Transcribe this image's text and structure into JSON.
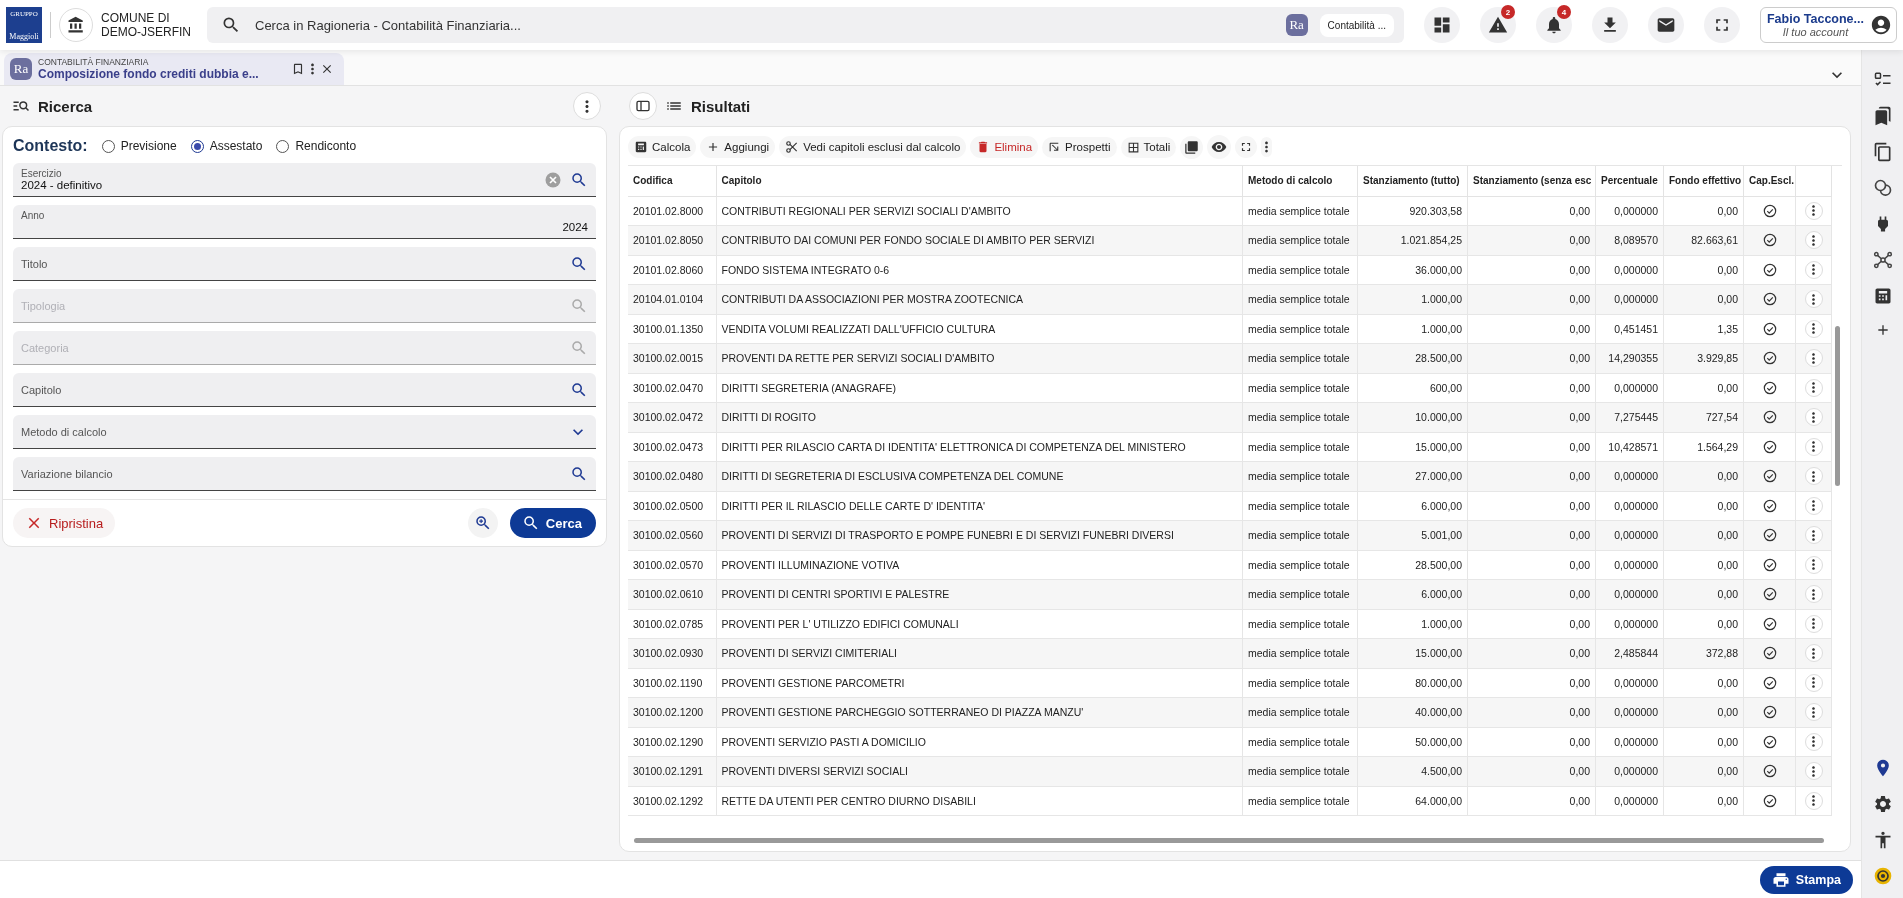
{
  "header": {
    "logo": {
      "top": "GRUPPO",
      "name": "Maggioli"
    },
    "entity": "COMUNE DI DEMO-JSERFIN",
    "search": {
      "placeholder": "Cerca in Ragioneria - Contabilità Finanziaria..."
    },
    "module_badge": "Ra",
    "module_chip": "Contabilità ...",
    "alert_count": "2",
    "notification_count": "4",
    "user": {
      "name": "Fabio Taccone...",
      "subtitle": "Il tuo account"
    }
  },
  "tab": {
    "badge": "Ra",
    "section": "CONTABILITÀ FINANZIARIA",
    "title": "Composizione fondo crediti dubbia e..."
  },
  "search_panel": {
    "title": "Ricerca",
    "context": {
      "label": "Contesto:",
      "options": [
        {
          "label": "Previsione",
          "selected": false
        },
        {
          "label": "Assestato",
          "selected": true
        },
        {
          "label": "Rendiconto",
          "selected": false
        }
      ]
    },
    "fields": [
      {
        "label": "Esercizio",
        "value": "2024 - definitivo",
        "kind": "lookup",
        "clearable": true,
        "disabled": false
      },
      {
        "label": "Anno",
        "value": "2024",
        "kind": "number",
        "clearable": false,
        "disabled": false
      },
      {
        "label": "Titolo",
        "kind": "lookup",
        "clearable": false,
        "disabled": false
      },
      {
        "label": "Tipologia",
        "kind": "lookup",
        "clearable": false,
        "disabled": true
      },
      {
        "label": "Categoria",
        "kind": "lookup",
        "clearable": false,
        "disabled": true
      },
      {
        "label": "Capitolo",
        "kind": "lookup",
        "clearable": false,
        "disabled": false
      },
      {
        "label": "Metodo di calcolo",
        "kind": "select",
        "clearable": false,
        "disabled": false
      },
      {
        "label": "Variazione bilancio",
        "kind": "lookup",
        "clearable": false,
        "disabled": false
      }
    ],
    "reset": "Ripristina",
    "search": "Cerca"
  },
  "results": {
    "title": "Risultati",
    "toolbar": [
      {
        "kind": "text",
        "label": "Calcola"
      },
      {
        "kind": "text",
        "label": "Aggiungi"
      },
      {
        "kind": "text",
        "label": "Vedi capitoli esclusi dal calcolo"
      },
      {
        "kind": "danger",
        "label": "Elimina"
      },
      {
        "kind": "text",
        "label": "Prospetti"
      },
      {
        "kind": "text",
        "label": "Totali"
      },
      {
        "kind": "icon"
      },
      {
        "kind": "icon"
      },
      {
        "kind": "icon"
      },
      {
        "kind": "icon"
      }
    ],
    "columns": [
      "Codifica",
      "Capitolo",
      "Metodo di calcolo",
      "Stanziamento (tutto)",
      "Stanziamento (senza esc",
      "Percentuale",
      "Fondo effettivo",
      "Cap.Escl."
    ],
    "rows": [
      [
        "20101.02.8000",
        "CONTRIBUTI REGIONALI PER SERVIZI SOCIALI D'AMBITO",
        "media semplice totale",
        "920.303,58",
        "0,00",
        "0,000000",
        "0,00"
      ],
      [
        "20101.02.8050",
        "CONTRIBUTO DAI COMUNI PER FONDO SOCIALE DI AMBITO PER SERVIZI",
        "media semplice totale",
        "1.021.854,25",
        "0,00",
        "8,089570",
        "82.663,61"
      ],
      [
        "20101.02.8060",
        "FONDO SISTEMA INTEGRATO 0-6",
        "media semplice totale",
        "36.000,00",
        "0,00",
        "0,000000",
        "0,00"
      ],
      [
        "20104.01.0104",
        "CONTRIBUTI DA ASSOCIAZIONI PER MOSTRA ZOOTECNICA",
        "media semplice totale",
        "1.000,00",
        "0,00",
        "0,000000",
        "0,00"
      ],
      [
        "30100.01.1350",
        "VENDITA VOLUMI REALIZZATI DALL'UFFICIO CULTURA",
        "media semplice totale",
        "1.000,00",
        "0,00",
        "0,451451",
        "1,35"
      ],
      [
        "30100.02.0015",
        "PROVENTI DA RETTE PER SERVIZI SOCIALI D'AMBITO",
        "media semplice totale",
        "28.500,00",
        "0,00",
        "14,290355",
        "3.929,85"
      ],
      [
        "30100.02.0470",
        "DIRITTI SEGRETERIA (ANAGRAFE)",
        "media semplice totale",
        "600,00",
        "0,00",
        "0,000000",
        "0,00"
      ],
      [
        "30100.02.0472",
        "DIRITTI DI ROGITO",
        "media semplice totale",
        "10.000,00",
        "0,00",
        "7,275445",
        "727,54"
      ],
      [
        "30100.02.0473",
        "DIRITTI PER RILASCIO CARTA DI IDENTITA' ELETTRONICA DI COMPETENZA DEL MINISTERO",
        "media semplice totale",
        "15.000,00",
        "0,00",
        "10,428571",
        "1.564,29"
      ],
      [
        "30100.02.0480",
        "DIRITTI DI SEGRETERIA DI ESCLUSIVA COMPETENZA DEL COMUNE",
        "media semplice totale",
        "27.000,00",
        "0,00",
        "0,000000",
        "0,00"
      ],
      [
        "30100.02.0500",
        "DIRITTI PER IL RILASCIO DELLE CARTE D' IDENTITA'",
        "media semplice totale",
        "6.000,00",
        "0,00",
        "0,000000",
        "0,00"
      ],
      [
        "30100.02.0560",
        "PROVENTI DI SERVIZI DI TRASPORTO E POMPE FUNEBRI E DI SERVIZI FUNEBRI DIVERSI",
        "media semplice totale",
        "5.001,00",
        "0,00",
        "0,000000",
        "0,00"
      ],
      [
        "30100.02.0570",
        "PROVENTI ILLUMINAZIONE VOTIVA",
        "media semplice totale",
        "28.500,00",
        "0,00",
        "0,000000",
        "0,00"
      ],
      [
        "30100.02.0610",
        "PROVENTI DI CENTRI SPORTIVI E PALESTRE",
        "media semplice totale",
        "6.000,00",
        "0,00",
        "0,000000",
        "0,00"
      ],
      [
        "30100.02.0785",
        "PROVENTI PER L' UTILIZZO EDIFICI COMUNALI",
        "media semplice totale",
        "1.000,00",
        "0,00",
        "0,000000",
        "0,00"
      ],
      [
        "30100.02.0930",
        "PROVENTI DI SERVIZI CIMITERIALI",
        "media semplice totale",
        "15.000,00",
        "0,00",
        "2,485844",
        "372,88"
      ],
      [
        "30100.02.1190",
        "PROVENTI GESTIONE PARCOMETRI",
        "media semplice totale",
        "80.000,00",
        "0,00",
        "0,000000",
        "0,00"
      ],
      [
        "30100.02.1200",
        "PROVENTI GESTIONE PARCHEGGIO SOTTERRANEO DI PIAZZA MANZU'",
        "media semplice totale",
        "40.000,00",
        "0,00",
        "0,000000",
        "0,00"
      ],
      [
        "30100.02.1290",
        "PROVENTI SERVIZIO PASTI A DOMICILIO",
        "media semplice totale",
        "50.000,00",
        "0,00",
        "0,000000",
        "0,00"
      ],
      [
        "30100.02.1291",
        "PROVENTI DIVERSI SERVIZI SOCIALI",
        "media semplice totale",
        "4.500,00",
        "0,00",
        "0,000000",
        "0,00"
      ],
      [
        "30100.02.1292",
        "RETTE DA UTENTI PER CENTRO DIURNO DISABILI",
        "media semplice totale",
        "64.000,00",
        "0,00",
        "0,000000",
        "0,00"
      ]
    ]
  },
  "footer": {
    "print": "Stampa"
  }
}
